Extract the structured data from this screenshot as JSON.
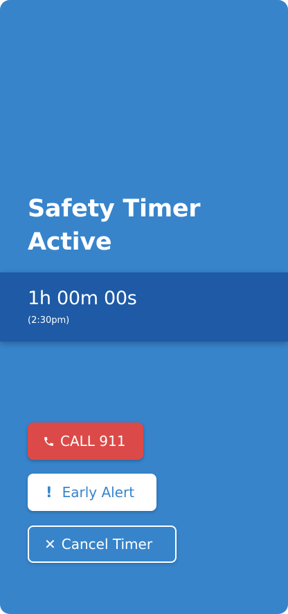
{
  "screen": {
    "title": "Safety Timer Active"
  },
  "timer": {
    "countdown": "1h 00m 00s",
    "end_time": "(2:30pm)"
  },
  "actions": {
    "call": {
      "label": "CALL 911",
      "icon": "phone-icon"
    },
    "early_alert": {
      "label": "Early Alert",
      "icon": "exclamation-icon",
      "icon_glyph": "!"
    },
    "cancel": {
      "label": "Cancel Timer",
      "icon": "close-icon",
      "icon_glyph": "✕"
    }
  },
  "colors": {
    "background": "#3784cb",
    "timer_band": "#1e5aa5",
    "danger": "#db4a48",
    "white": "#ffffff"
  }
}
